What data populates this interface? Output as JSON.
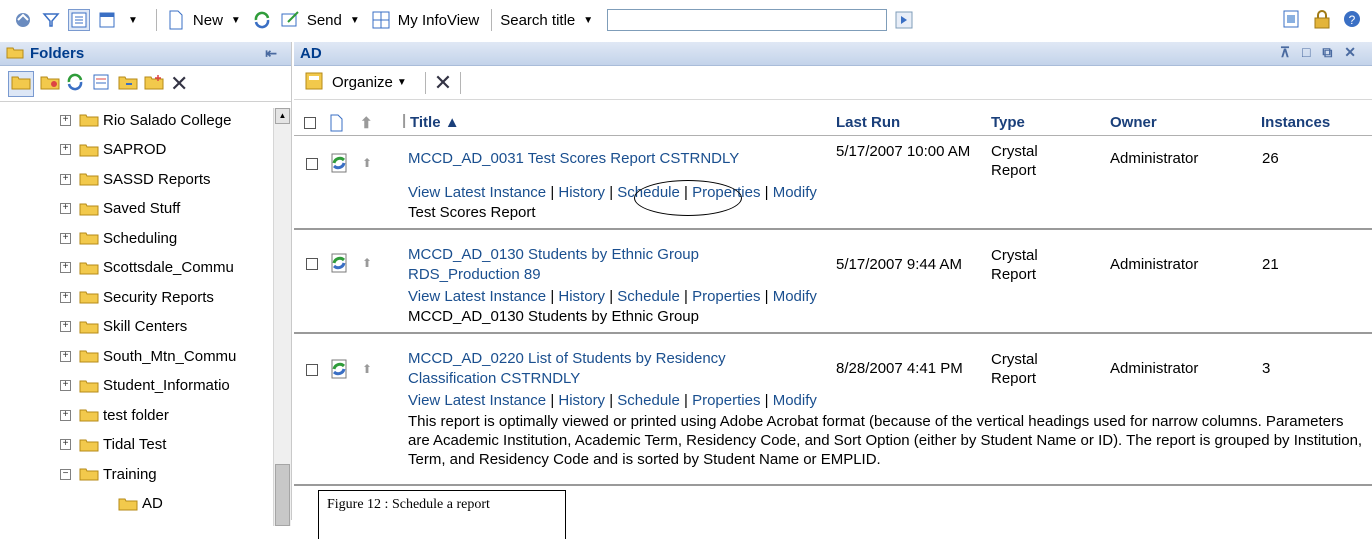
{
  "toolbar": {
    "new_label": "New",
    "send_label": "Send",
    "infoview_label": "My InfoView",
    "search_mode_label": "Search title",
    "search_value": ""
  },
  "folders": {
    "title": "Folders",
    "items": [
      {
        "label": "Rio Salado College",
        "expander": "+"
      },
      {
        "label": "SAPROD",
        "expander": "+"
      },
      {
        "label": "SASSD Reports",
        "expander": "+"
      },
      {
        "label": "Saved Stuff",
        "expander": "+"
      },
      {
        "label": "Scheduling",
        "expander": "+"
      },
      {
        "label": "Scottsdale_Commu",
        "expander": "+"
      },
      {
        "label": "Security Reports",
        "expander": "+"
      },
      {
        "label": "Skill Centers",
        "expander": "+"
      },
      {
        "label": "South_Mtn_Commu",
        "expander": "+"
      },
      {
        "label": "Student_Informatio",
        "expander": "+"
      },
      {
        "label": "test folder",
        "expander": "+"
      },
      {
        "label": "Tidal Test",
        "expander": "+"
      },
      {
        "label": "Training",
        "expander": "−"
      },
      {
        "label": "AD",
        "expander": ""
      }
    ]
  },
  "ad_panel": {
    "title": "AD",
    "organize_label": "Organize",
    "columns": {
      "title": "Title ▲",
      "last_run": "Last Run",
      "type": "Type",
      "owner": "Owner",
      "instances": "Instances"
    },
    "rows": [
      {
        "title": "MCCD_AD_0031 Test Scores Report CSTRNDLY",
        "title_line2": "",
        "last_run": "5/17/2007 10:00 AM",
        "type": "Crystal Report",
        "owner": "Administrator",
        "instances": "26",
        "actions": [
          "View Latest Instance",
          "History",
          "Schedule",
          "Properties",
          "Modify"
        ],
        "description": "Test Scores Report"
      },
      {
        "title": "MCCD_AD_0130 Students by Ethnic Group",
        "title_line2": "RDS_Production 89",
        "last_run": "5/17/2007 9:44 AM",
        "type": "Crystal Report",
        "owner": "Administrator",
        "instances": "21",
        "actions": [
          "View Latest Instance",
          "History",
          "Schedule",
          "Properties",
          "Modify"
        ],
        "description": "MCCD_AD_0130 Students by Ethnic Group"
      },
      {
        "title": "MCCD_AD_0220 List of Students by Residency",
        "title_line2": "Classification CSTRNDLY",
        "last_run": "8/28/2007 4:41 PM",
        "type": "Crystal Report",
        "owner": "Administrator",
        "instances": "3",
        "actions": [
          "View Latest Instance",
          "History",
          "Schedule",
          "Properties",
          "Modify"
        ],
        "description": "This report is optimally viewed or printed using Adobe Acrobat format (because of the vertical headings used for narrow columns. Parameters are Academic Institution, Academic Term, Residency Code, and Sort Option (either by Student Name or ID). The report is grouped by Institution, Term, and Residency Code and is sorted by Student Name or EMPLID."
      }
    ]
  },
  "figure_caption": "Figure 12 : Schedule a report"
}
